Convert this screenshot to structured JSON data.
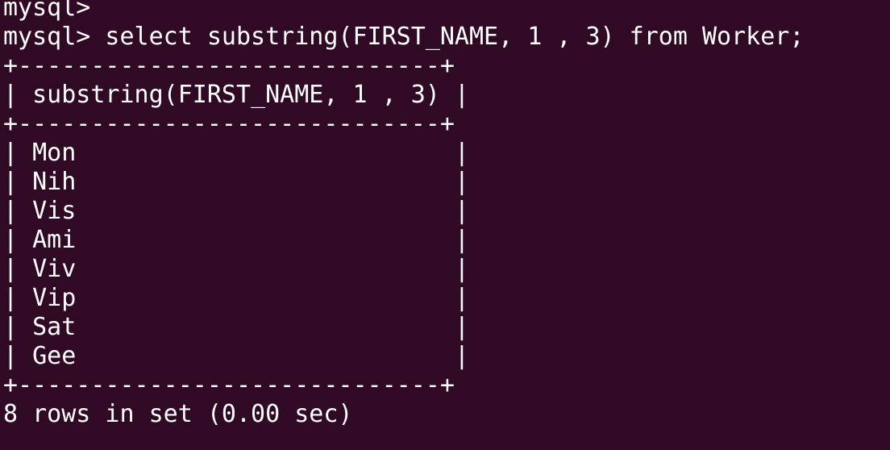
{
  "terminal": {
    "lines": [
      "mysql>",
      "mysql> select substring(FIRST_NAME, 1 , 3) from Worker;",
      "+-----------------------------+",
      "| substring(FIRST_NAME, 1 , 3) |",
      "+-----------------------------+",
      "| Mon                          |",
      "| Nih                          |",
      "| Vis                          |",
      "| Ami                          |",
      "| Viv                          |",
      "| Vip                          |",
      "| Sat                          |",
      "| Gee                          |",
      "+-----------------------------+",
      "8 rows in set (0.00 sec)"
    ]
  }
}
